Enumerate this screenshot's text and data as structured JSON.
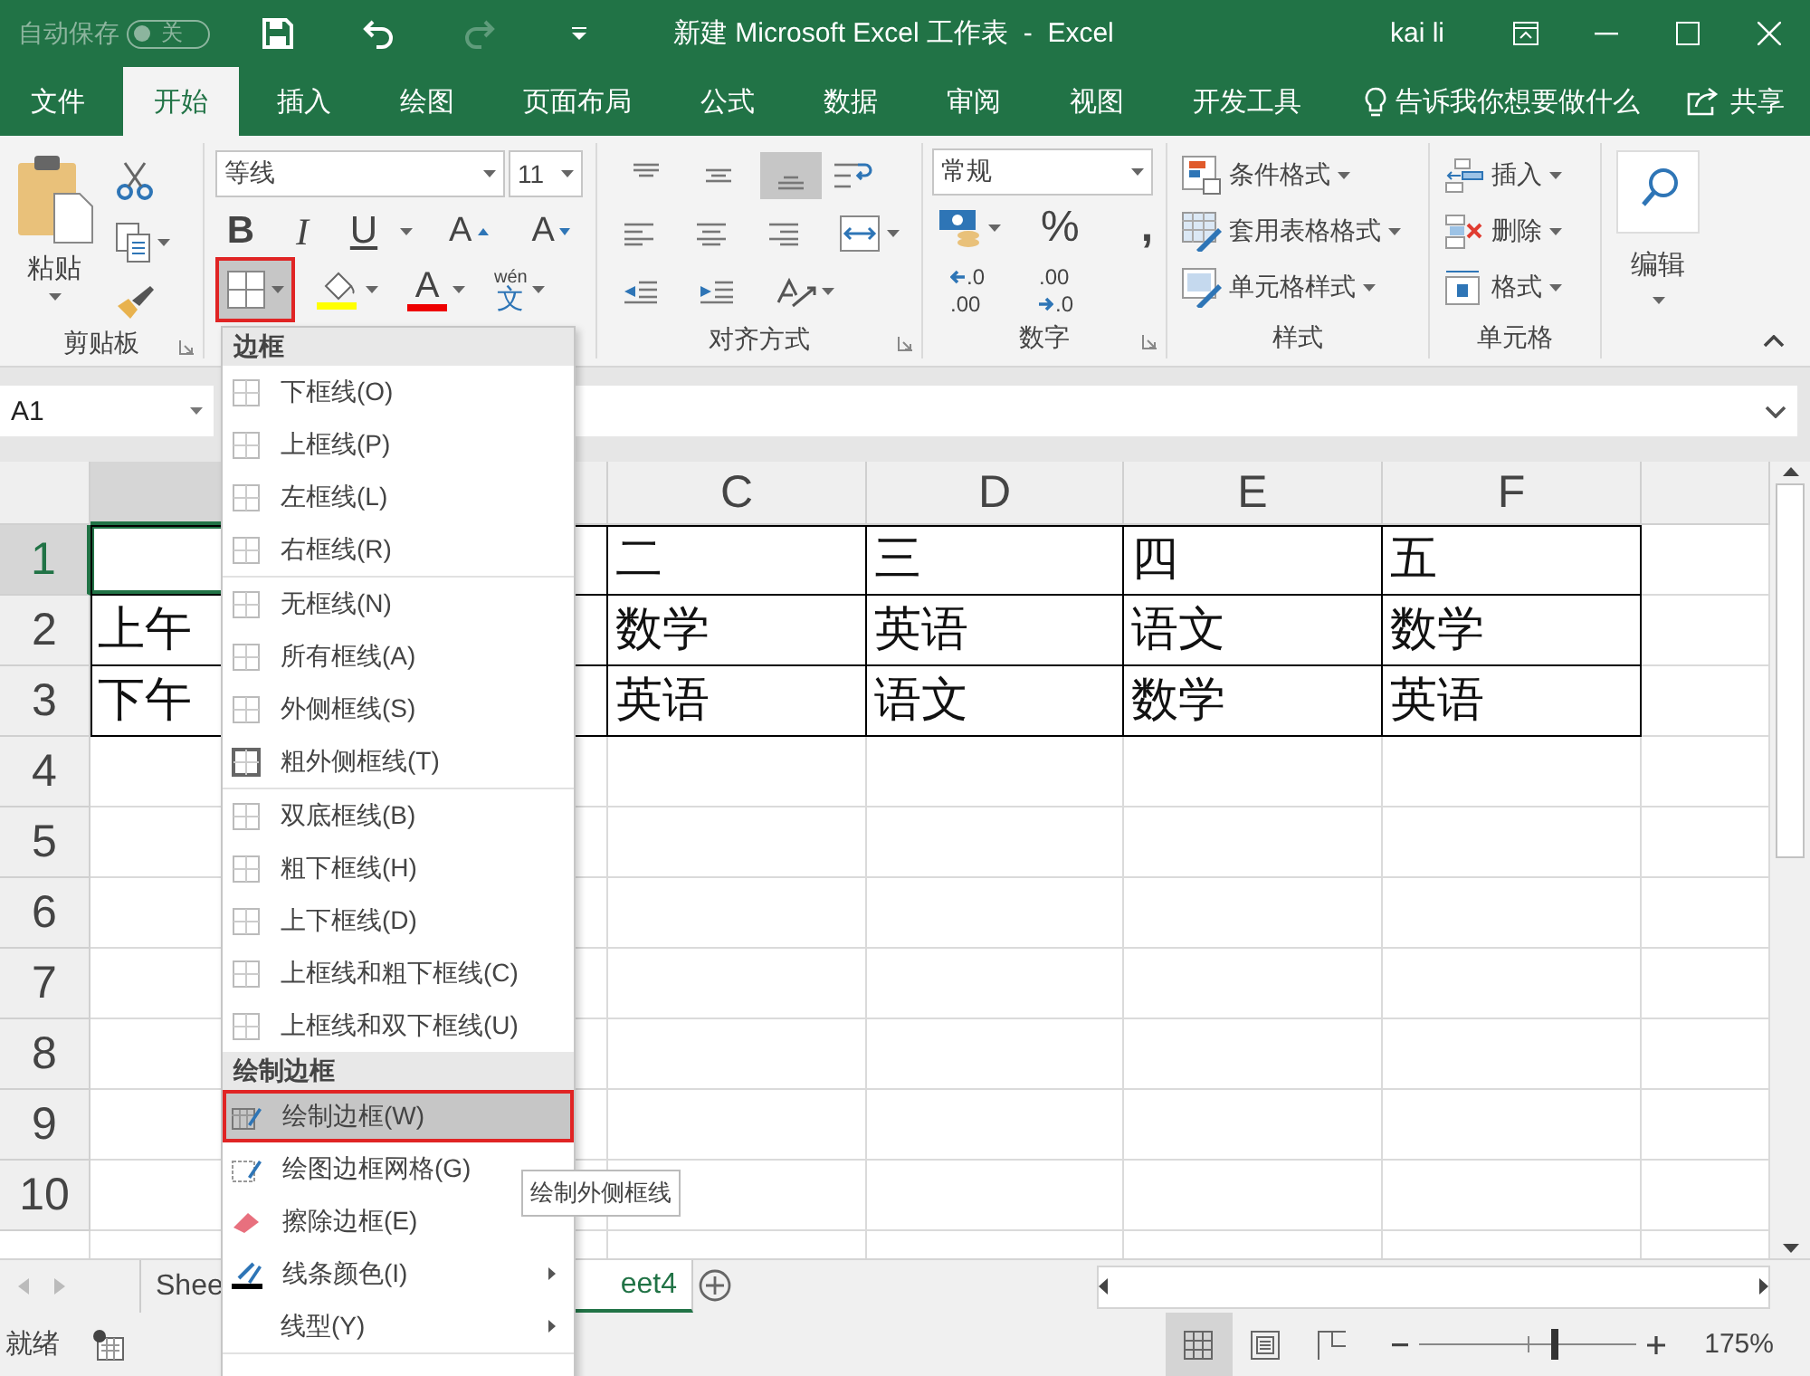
{
  "title_bar": {
    "autosave": {
      "label": "自动保存",
      "state": "关",
      "on": false
    },
    "title": "新建 Microsoft Excel 工作表  -  Excel",
    "user": "kai li"
  },
  "tabs": [
    {
      "label": "文件",
      "selected": false
    },
    {
      "label": "开始",
      "selected": true
    },
    {
      "label": "插入",
      "selected": false
    },
    {
      "label": "绘图",
      "selected": false
    },
    {
      "label": "页面布局",
      "selected": false
    },
    {
      "label": "公式",
      "selected": false
    },
    {
      "label": "数据",
      "selected": false
    },
    {
      "label": "审阅",
      "selected": false
    },
    {
      "label": "视图",
      "selected": false
    },
    {
      "label": "开发工具",
      "selected": false
    }
  ],
  "tell_me": "告诉我你想要做什么",
  "share": "共享",
  "ribbon": {
    "clipboard": {
      "paste": "粘贴",
      "label": "剪贴板"
    },
    "font": {
      "name": "等线",
      "size": "11",
      "styles": [
        "B",
        "I",
        "U"
      ],
      "size_buttons": [
        "A",
        "A"
      ],
      "border_button": {
        "selected": true
      },
      "font_color_letter": "A",
      "phonetic": {
        "top": "wén",
        "bottom": "文"
      }
    },
    "alignment": {
      "vertical": [
        {
          "kind": "top",
          "selected": false
        },
        {
          "kind": "middle",
          "selected": false
        },
        {
          "kind": "bottom",
          "selected": true
        }
      ],
      "label": "对齐方式"
    },
    "number": {
      "format": "常规",
      "percent": "%",
      "comma": ",",
      "decimals": [
        {
          "kind": "decrease",
          "top": ".0",
          "bottom": ".00"
        },
        {
          "kind": "increase",
          "top": ".00",
          "bottom": ".0"
        }
      ],
      "label": "数字"
    },
    "styles": {
      "items": [
        "条件格式",
        "套用表格格式",
        "单元格样式"
      ],
      "label": "样式"
    },
    "cells": {
      "items": [
        "插入",
        "删除",
        "格式"
      ],
      "label": "单元格"
    },
    "editing": {
      "label": "编辑"
    }
  },
  "name_box": "A1",
  "sheet": {
    "columns": [
      {
        "selected": true
      },
      {
        "selected": false
      },
      {
        "label": "C",
        "selected": false
      },
      {
        "label": "D",
        "selected": false
      },
      {
        "label": "E",
        "selected": false
      },
      {
        "label": "F",
        "selected": false
      },
      {
        "selected": false
      }
    ],
    "rows": [
      {
        "label": "1",
        "selected": true,
        "bordered": true,
        "cells": [
          null,
          null,
          "二",
          "三",
          "四",
          "五"
        ]
      },
      {
        "label": "2",
        "selected": false,
        "bordered": true,
        "cells": [
          "上午",
          null,
          "数学",
          "英语",
          "语文",
          "数学"
        ]
      },
      {
        "label": "3",
        "selected": false,
        "bordered": true,
        "cells": [
          "下午",
          null,
          "英语",
          "语文",
          "数学",
          "英语"
        ]
      },
      {
        "label": "4",
        "selected": false,
        "bordered": false
      },
      {
        "label": "5",
        "selected": false,
        "bordered": false
      },
      {
        "label": "6",
        "selected": false,
        "bordered": false
      },
      {
        "label": "7",
        "selected": false,
        "bordered": false
      },
      {
        "label": "8",
        "selected": false,
        "bordered": false
      },
      {
        "label": "9",
        "selected": false,
        "bordered": false
      },
      {
        "label": "10",
        "selected": false,
        "bordered": false
      }
    ]
  },
  "border_menu": {
    "sections": [
      {
        "title": "边框",
        "groups": [
          [
            {
              "kind": "border",
              "label": "下框线(O)",
              "selected": false
            },
            {
              "kind": "border",
              "label": "上框线(P)",
              "selected": false
            },
            {
              "kind": "border",
              "label": "左框线(L)",
              "selected": false
            },
            {
              "kind": "border",
              "label": "右框线(R)",
              "selected": false
            }
          ],
          [
            {
              "kind": "border",
              "label": "无框线(N)",
              "selected": false
            },
            {
              "kind": "border",
              "label": "所有框线(A)",
              "selected": false
            },
            {
              "kind": "border",
              "label": "外侧框线(S)",
              "selected": false
            },
            {
              "kind": "thick-border",
              "label": "粗外侧框线(T)",
              "selected": false
            }
          ],
          [
            {
              "kind": "border",
              "label": "双底框线(B)",
              "selected": false
            },
            {
              "kind": "border",
              "label": "粗下框线(H)",
              "selected": false
            },
            {
              "kind": "border",
              "label": "上下框线(D)",
              "selected": false
            },
            {
              "kind": "border",
              "label": "上框线和粗下框线(C)",
              "selected": false
            },
            {
              "kind": "border",
              "label": "上框线和双下框线(U)",
              "selected": false
            }
          ]
        ]
      },
      {
        "title": "绘制边框",
        "groups": [
          [
            {
              "kind": "draw",
              "label": "绘制边框(W)",
              "selected": true,
              "submenu": false
            },
            {
              "kind": "draw-grid",
              "label": "绘图边框网格(G)",
              "selected": false,
              "submenu": false
            },
            {
              "kind": "erase",
              "label": "擦除边框(E)",
              "selected": false,
              "submenu": false
            },
            {
              "kind": "line-color",
              "label": "线条颜色(I)",
              "selected": false,
              "submenu": true
            },
            {
              "kind": "line-style",
              "label": "线型(Y)",
              "selected": false,
              "submenu": true
            }
          ]
        ]
      }
    ]
  },
  "tooltip": "绘制外侧框线",
  "sheet_tabs": [
    {
      "label": "Shee",
      "selected": false
    },
    {
      "label": "eet4",
      "selected": true
    }
  ],
  "status_bar": {
    "text": "就绪",
    "views": [
      {
        "kind": "normal",
        "selected": true
      },
      {
        "kind": "page-layout",
        "selected": false
      },
      {
        "kind": "page-break",
        "selected": false
      }
    ],
    "zoom": {
      "level": 0.625,
      "reading": "175%"
    }
  }
}
